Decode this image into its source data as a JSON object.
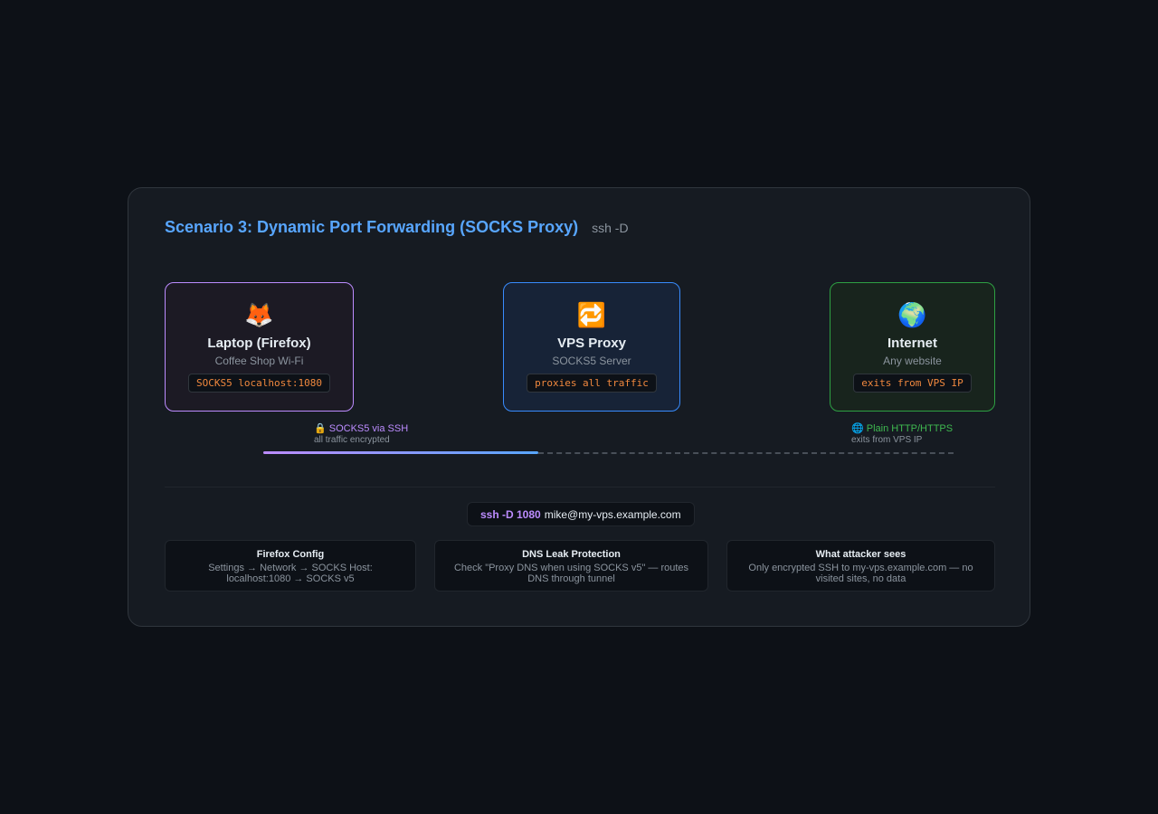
{
  "header": {
    "title": "Scenario 3: Dynamic Port Forwarding (SOCKS Proxy)",
    "command_hint": "ssh -D"
  },
  "nodes": [
    {
      "icon": "fox-icon",
      "glyph": "🦊",
      "name": "Laptop (Firefox)",
      "subtitle": "Coffee Shop Wi-Fi",
      "code": "SOCKS5 localhost:1080",
      "border_color": "#bc8cff"
    },
    {
      "icon": "repeat-arrows-icon",
      "glyph": "🔁",
      "name": "VPS Proxy",
      "subtitle": "SOCKS5 Server",
      "code": "proxies all traffic",
      "border_color": "#388bfd"
    },
    {
      "icon": "globe-icon",
      "glyph": "🌍",
      "name": "Internet",
      "subtitle": "Any website",
      "code": "exits from VPS IP",
      "border_color": "#2ea043"
    }
  ],
  "links": {
    "ssh": {
      "icon": "lock-icon",
      "label": "🔒 SOCKS5 via SSH",
      "note": "all traffic encrypted",
      "color": "#bc8cff"
    },
    "plain": {
      "icon": "globe-small-icon",
      "label": "🌐 Plain HTTP/HTTPS",
      "note": "exits from VPS IP",
      "color": "#3fb950"
    }
  },
  "command": {
    "flag": "ssh -D 1080",
    "target": "mike@my-vps.example.com"
  },
  "info_boxes": [
    {
      "title": "Firefox Config",
      "body": "Settings → Network → SOCKS Host: localhost:1080 → SOCKS v5"
    },
    {
      "title": "DNS Leak Protection",
      "body": "Check \"Proxy DNS when using SOCKS v5\" — routes DNS through tunnel"
    },
    {
      "title": "What attacker sees",
      "body": "Only encrypted SSH to my-vps.example.com — no visited sites, no data"
    }
  ],
  "colors": {
    "accent": "#58a6ff",
    "ssh": "#bc8cff",
    "plain": "#3fb950",
    "code": "#f0883e"
  }
}
